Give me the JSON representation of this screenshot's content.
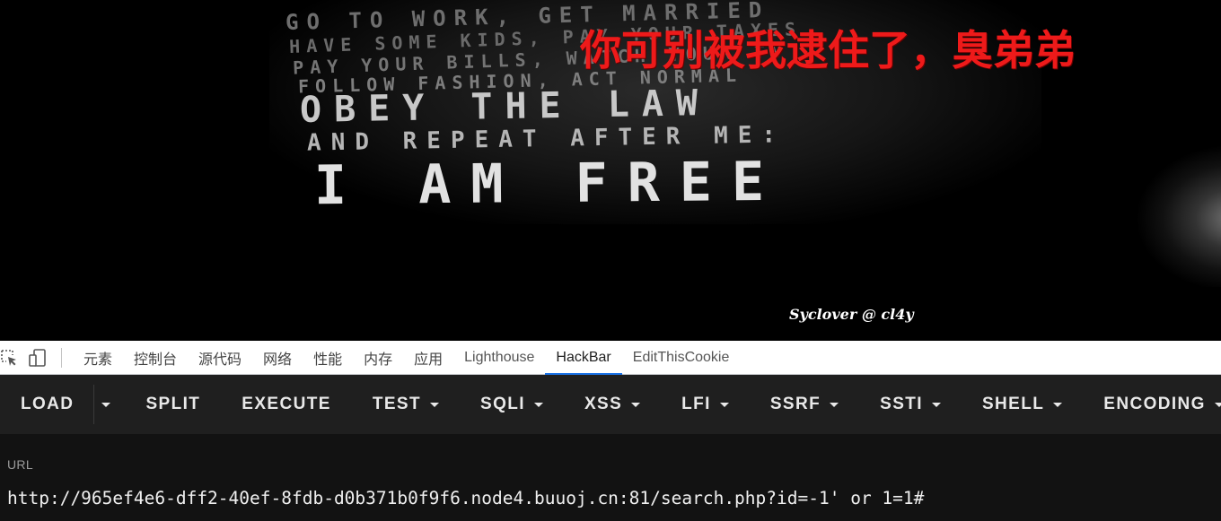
{
  "poster": {
    "lines": [
      "Go to work, get married",
      "have some kids, pay your taxes",
      "pay your bills, watch your tv",
      "follow fashion, act normal",
      "obey the law",
      "and repeat after me:",
      "I am free"
    ]
  },
  "page": {
    "title_text": "你可别被我逮住了，臭弟弟",
    "title_color": "#ee1a1a",
    "credit": "Syclover @ cl4y"
  },
  "devtools": {
    "tabs": [
      {
        "label": "元素"
      },
      {
        "label": "控制台"
      },
      {
        "label": "源代码"
      },
      {
        "label": "网络"
      },
      {
        "label": "性能"
      },
      {
        "label": "内存"
      },
      {
        "label": "应用"
      },
      {
        "label": "Lighthouse"
      },
      {
        "label": "HackBar",
        "active": true
      },
      {
        "label": "EditThisCookie"
      }
    ],
    "accent_color": "#1a73e8"
  },
  "hackbar": {
    "buttons": {
      "load": "LOAD",
      "split": "SPLIT",
      "execute": "EXECUTE",
      "test": "TEST",
      "sqli": "SQLI",
      "xss": "XSS",
      "lfi": "LFI",
      "ssrf": "SSRF",
      "ssti": "SSTI",
      "shell": "SHELL",
      "encoding": "ENCODING"
    },
    "url_label": "URL",
    "url_value": "http://965ef4e6-dff2-40ef-8fdb-d0b371b0f9f6.node4.buuoj.cn:81/search.php?id=-1' or 1=1#"
  }
}
